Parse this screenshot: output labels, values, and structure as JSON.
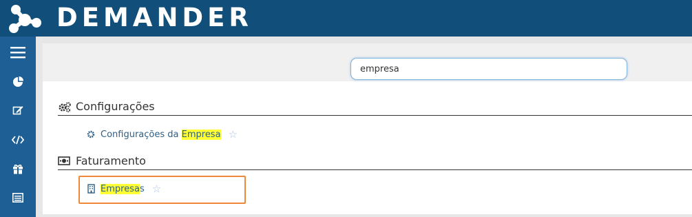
{
  "app": {
    "logo_text": "DEMANDER"
  },
  "colors": {
    "header": "#114f7a",
    "sidebar": "#1e5f95",
    "highlight": "#ffff33",
    "focus_outline": "#f0883a"
  },
  "sidebar": {
    "items": [
      {
        "icon": "hamburger-menu-icon"
      },
      {
        "icon": "pie-chart-icon"
      },
      {
        "icon": "edit-icon"
      },
      {
        "icon": "code-icon"
      },
      {
        "icon": "gift-icon"
      },
      {
        "icon": "list-icon"
      }
    ]
  },
  "search": {
    "value": "empresa"
  },
  "sections": [
    {
      "title": "Configurações",
      "icon": "cogs-icon",
      "results": [
        {
          "icon": "gear-icon",
          "text_before": "Configurações da ",
          "text_match": "Empresa",
          "text_after": ""
        }
      ]
    },
    {
      "title": "Faturamento",
      "icon": "money-bill-icon",
      "results": [
        {
          "icon": "building-icon",
          "text_before": "",
          "text_match": "Empresa",
          "text_after": "s"
        }
      ]
    }
  ]
}
